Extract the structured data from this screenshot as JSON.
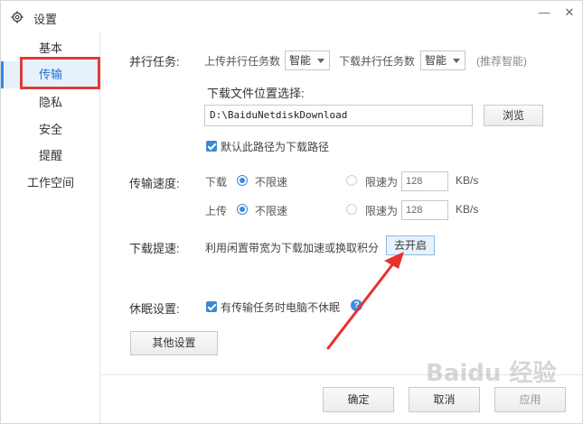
{
  "window": {
    "title": "设置",
    "minimize": "—",
    "close": "✕"
  },
  "sidebar": {
    "items": [
      {
        "label": "基本"
      },
      {
        "label": "传输"
      },
      {
        "label": "隐私"
      },
      {
        "label": "安全"
      },
      {
        "label": "提醒"
      },
      {
        "label": "工作空间"
      }
    ]
  },
  "parallel": {
    "label": "并行任务:",
    "upload_label": "上传并行任务数",
    "upload_value": "智能",
    "download_label": "下载并行任务数",
    "download_value": "智能",
    "hint": "(推荐智能)"
  },
  "download_location": {
    "label": "下载文件位置选择:",
    "path": "D:\\BaiduNetdiskDownload",
    "browse": "浏览",
    "default_checkbox": "默认此路径为下载路径"
  },
  "speed": {
    "label": "传输速度:",
    "download": {
      "label": "下载",
      "unlimited": "不限速",
      "limited": "限速为",
      "value": "128",
      "unit": "KB/s"
    },
    "upload": {
      "label": "上传",
      "unlimited": "不限速",
      "limited": "限速为",
      "value": "128",
      "unit": "KB/s"
    }
  },
  "boost": {
    "label": "下载提速:",
    "desc": "利用闲置带宽为下载加速或换取积分",
    "button": "去开启"
  },
  "sleep": {
    "label": "休眠设置:",
    "checkbox": "有传输任务时电脑不休眠",
    "help": "?"
  },
  "other_settings": "其他设置",
  "footer": {
    "ok": "确定",
    "cancel": "取消",
    "apply": "应用"
  },
  "watermark": "Baidu 经验",
  "colors": {
    "accent": "#2d8cf0",
    "highlight_box": "#e03a3a",
    "arrow": "#e8302f"
  }
}
